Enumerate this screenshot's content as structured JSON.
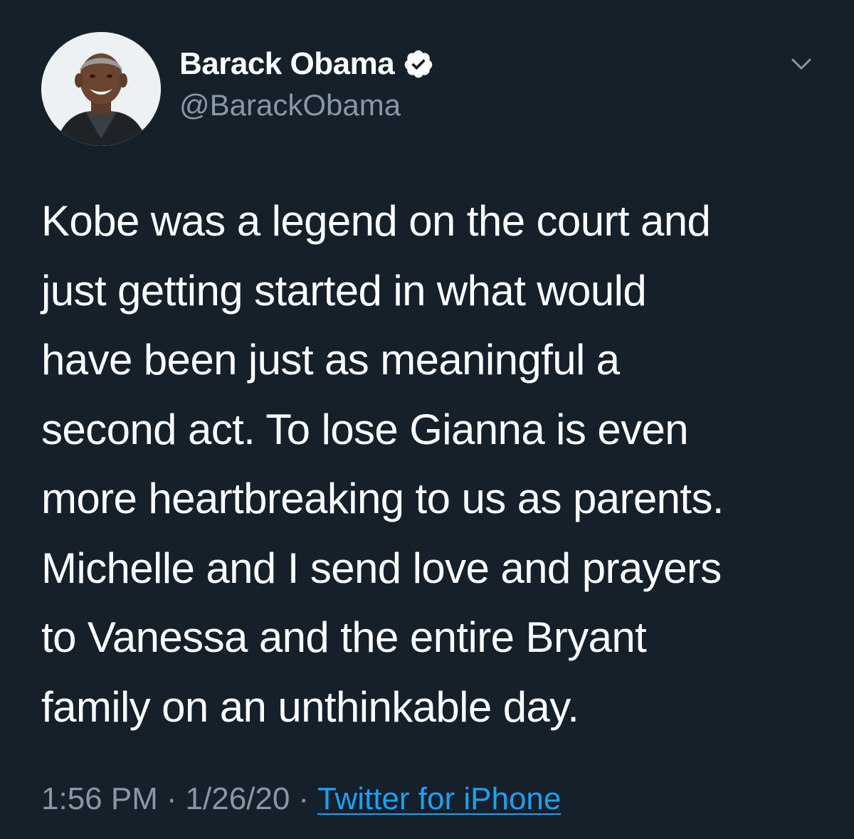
{
  "colors": {
    "background": "#15202b",
    "text": "#ffffff",
    "secondary_text": "#8899a6",
    "link": "#1da1f2",
    "verified_badge": "#ffffff"
  },
  "author": {
    "display_name": "Barack Obama",
    "handle": "@BarackObama",
    "verified": true,
    "avatar_icon": "profile-photo",
    "verified_icon": "verified-badge-icon"
  },
  "menu": {
    "icon": "chevron-down-icon"
  },
  "tweet": {
    "lines": [
      "Kobe was a legend on the court and",
      "just getting started in what would",
      "have been just as meaningful a",
      "second act. To lose Gianna is even",
      "more heartbreaking to us as parents.",
      "Michelle and I send love and prayers",
      "to Vanessa and the entire Bryant",
      "family on an unthinkable day."
    ]
  },
  "meta": {
    "time": "1:56 PM",
    "separator": "·",
    "date": "1/26/20",
    "source": "Twitter for iPhone"
  }
}
